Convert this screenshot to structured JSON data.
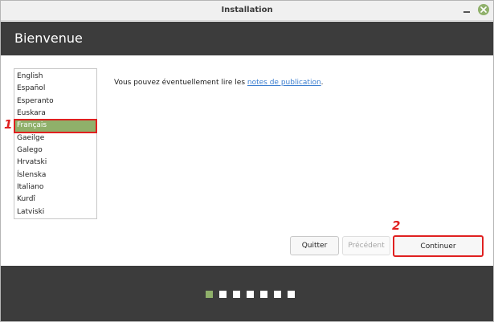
{
  "window": {
    "title": "Installation"
  },
  "header": {
    "title": "Bienvenue"
  },
  "languages": {
    "items": [
      "English",
      "Español",
      "Esperanto",
      "Euskara",
      "Français",
      "Gaeilge",
      "Galego",
      "Hrvatski",
      "Íslenska",
      "Italiano",
      "Kurdî",
      "Latviski"
    ],
    "selected": "Français"
  },
  "notes": {
    "prefix": "Vous pouvez éventuellement lire les ",
    "link": "notes de publication",
    "suffix": "."
  },
  "buttons": {
    "quit": "Quitter",
    "previous": "Précédent",
    "continue": "Continuer"
  },
  "annotations": {
    "marker_1": "1",
    "marker_2": "2"
  },
  "progress": {
    "total_steps": 7,
    "current_step": 1
  },
  "colors": {
    "accent": "#8fb06a",
    "highlight": "#e02020",
    "dark": "#3c3c3c"
  }
}
